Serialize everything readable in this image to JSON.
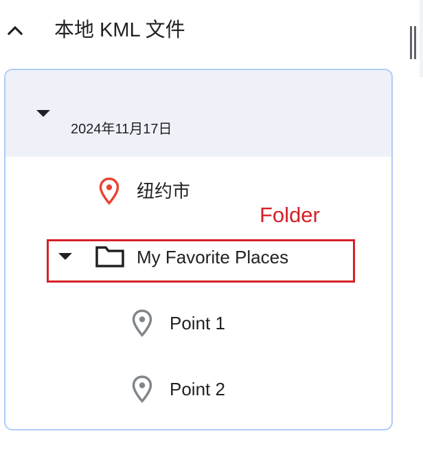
{
  "header": {
    "title": "本地 KML 文件",
    "collapse_icon": "chevron-up-icon"
  },
  "tree": {
    "date_group": {
      "label": "2024年11月17日",
      "expanded": true
    },
    "placemark": {
      "label": "纽约市",
      "icon": "map-pin-icon",
      "icon_color": "#ea4335"
    },
    "folder": {
      "label": "My Favorite Places",
      "icon": "folder-icon",
      "expanded": true,
      "children": [
        {
          "label": "Point 1",
          "icon": "map-pin-icon",
          "icon_color": "#80868b"
        },
        {
          "label": "Point 2",
          "icon": "map-pin-icon",
          "icon_color": "#80868b"
        }
      ]
    }
  },
  "annotation": {
    "label": "Folder",
    "color": "#d61f26"
  },
  "colors": {
    "panel_border": "#aecbfa",
    "selected_row_bg": "#eef2f8",
    "text": "#202124"
  }
}
